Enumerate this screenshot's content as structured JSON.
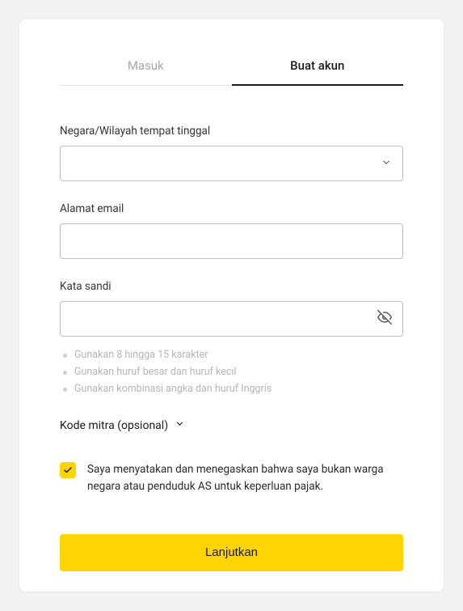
{
  "tabs": {
    "login": "Masuk",
    "signup": "Buat akun"
  },
  "country": {
    "label": "Negara/Wilayah tempat tinggal",
    "value": ""
  },
  "email": {
    "label": "Alamat email",
    "value": ""
  },
  "password": {
    "label": "Kata sandi",
    "value": "",
    "rules": [
      "Gunakan 8 hingga 15 karakter",
      "Gunakan huruf besar dan huruf kecil",
      "Gunakan kombinasi angka dan huruf Inggris"
    ]
  },
  "partner": {
    "label": "Kode mitra (opsional)"
  },
  "disclaimer": {
    "checked": true,
    "text": "Saya menyatakan dan menegaskan bahwa saya bukan warga negara atau penduduk AS untuk keperluan pajak."
  },
  "submit": {
    "label": "Lanjutkan"
  },
  "colors": {
    "accent": "#ffd400"
  }
}
